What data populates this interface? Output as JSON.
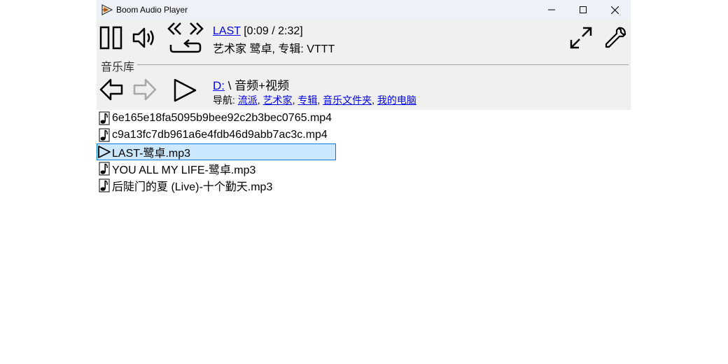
{
  "window": {
    "title": "Boom Audio Player"
  },
  "now_playing": {
    "track_link": "LAST",
    "time": "[0:09 / 2:32]",
    "details": "艺术家 鹭卓, 专辑: VTTT"
  },
  "library": {
    "label": "音乐库",
    "drive_link": "D:",
    "path_rest": "\\ 音频+视频",
    "nav_label": "导航: ",
    "nav_links": [
      "流派",
      "艺术家",
      "专辑",
      "音乐文件夹",
      "我的电脑"
    ],
    "nav_sep": ", "
  },
  "files": [
    {
      "name": "6e165e18fa5095b9bee92c2b3bec0765.mp4",
      "icon": "music-note-icon"
    },
    {
      "name": "c9a13fc7db961a6e4fdb46d9abb7ac3c.mp4",
      "icon": "music-note-icon"
    },
    {
      "name": "LAST-鹭卓.mp3",
      "icon": "play-indicator-icon",
      "selected": true
    },
    {
      "name": "YOU ALL MY LIFE-鹭卓.mp3",
      "icon": "music-note-icon"
    },
    {
      "name": "后陡门的夏 (Live)-十个勤天.mp3",
      "icon": "music-note-icon"
    }
  ]
}
